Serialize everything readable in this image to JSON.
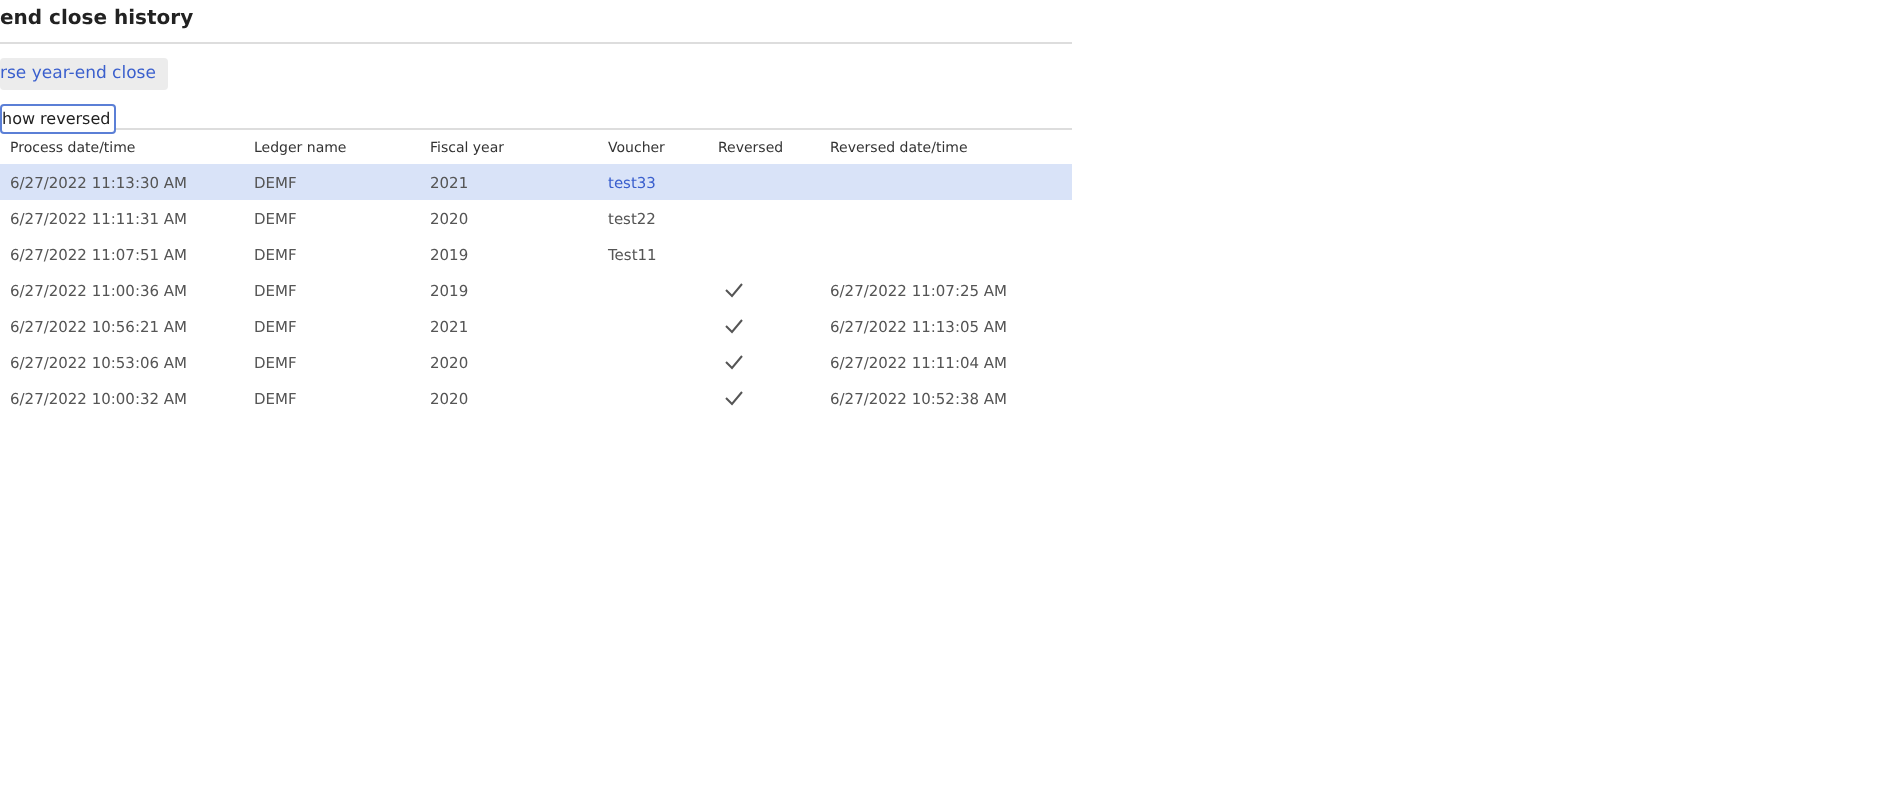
{
  "title": "end close history",
  "toolbar": {
    "button": "rse year-end close"
  },
  "filter": {
    "label": "how reversed"
  },
  "table": {
    "columns": [
      "Process date/time",
      "Ledger name",
      "Fiscal year",
      "Voucher",
      "Reversed",
      "Reversed date/time"
    ],
    "rows": [
      {
        "process": "6/27/2022 11:13:30 AM",
        "ledger": "DEMF",
        "year": "2021",
        "voucher": "test33",
        "reversed": false,
        "selected": true
      },
      {
        "process": "6/27/2022 11:11:31 AM",
        "ledger": "DEMF",
        "year": "2020",
        "voucher": "test22",
        "reversed": false,
        "selected": false
      },
      {
        "process": "6/27/2022 11:07:51 AM",
        "ledger": "DEMF",
        "year": "2019",
        "voucher": "Test11",
        "reversed": false,
        "selected": false
      },
      {
        "process": "6/27/2022 11:00:36 AM",
        "ledger": "DEMF",
        "year": "2019",
        "reversed": true,
        "reversed_at": "6/27/2022 11:07:25 AM",
        "selected": false
      },
      {
        "process": "6/27/2022 10:56:21 AM",
        "ledger": "DEMF",
        "year": "2021",
        "reversed": true,
        "reversed_at": "6/27/2022 11:13:05 AM",
        "selected": false
      },
      {
        "process": "6/27/2022 10:53:06 AM",
        "ledger": "DEMF",
        "year": "2020",
        "reversed": true,
        "reversed_at": "6/27/2022 11:11:04 AM",
        "selected": false
      },
      {
        "process": "6/27/2022 10:00:32 AM",
        "ledger": "DEMF",
        "year": "2020",
        "reversed": true,
        "reversed_at": "6/27/2022 10:52:38 AM",
        "selected": false
      }
    ]
  }
}
